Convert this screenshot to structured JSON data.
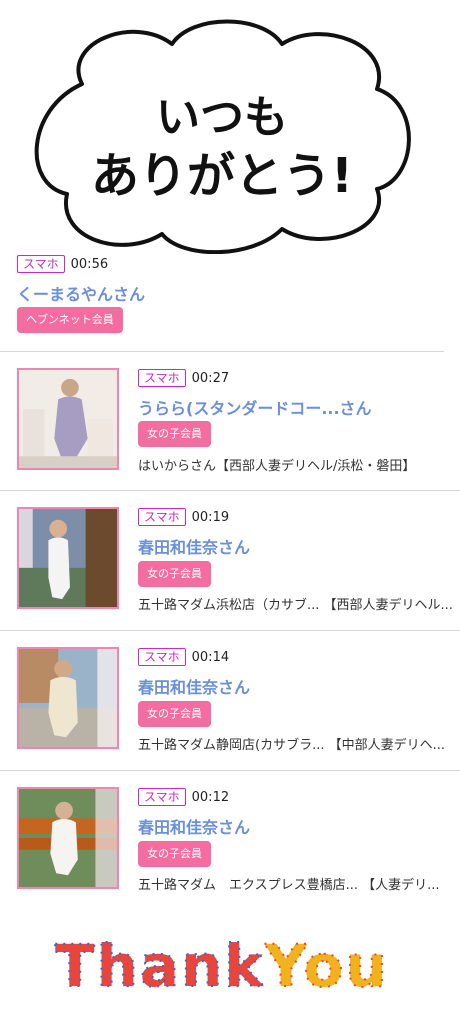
{
  "banner": {
    "line1": "いつも",
    "line2": "ありがとう!"
  },
  "visits": [
    {
      "device": "スマホ",
      "time": "00:56",
      "name": "くーまるやんさん",
      "member": "ヘブンネット会員",
      "shop": ""
    },
    {
      "device": "スマホ",
      "time": "00:27",
      "name": "うらら(スタンダードコー...さん",
      "member": "女の子会員",
      "shop": "はいからさん【西部人妻デリヘル/浜松・磐田】"
    },
    {
      "device": "スマホ",
      "time": "00:19",
      "name": "春田和佳奈さん",
      "member": "女の子会員",
      "shop": "五十路マダム浜松店（カサブ... 【西部人妻デリヘル..."
    },
    {
      "device": "スマホ",
      "time": "00:14",
      "name": "春田和佳奈さん",
      "member": "女の子会員",
      "shop": "五十路マダム静岡店(カサブラ... 【中部人妻デリヘ..."
    },
    {
      "device": "スマホ",
      "time": "00:12",
      "name": "春田和佳奈さん",
      "member": "女の子会員",
      "shop": "五十路マダム　エクスプレス豊橋店... 【人妻デリ..."
    }
  ],
  "footer": {
    "word1": "Thank",
    "word2": "You"
  },
  "colors": {
    "device_badge": "#c62dbe",
    "name_link": "#6b8fd9",
    "member_badge": "#f36da1",
    "thumb_border": "#ef86b2"
  }
}
